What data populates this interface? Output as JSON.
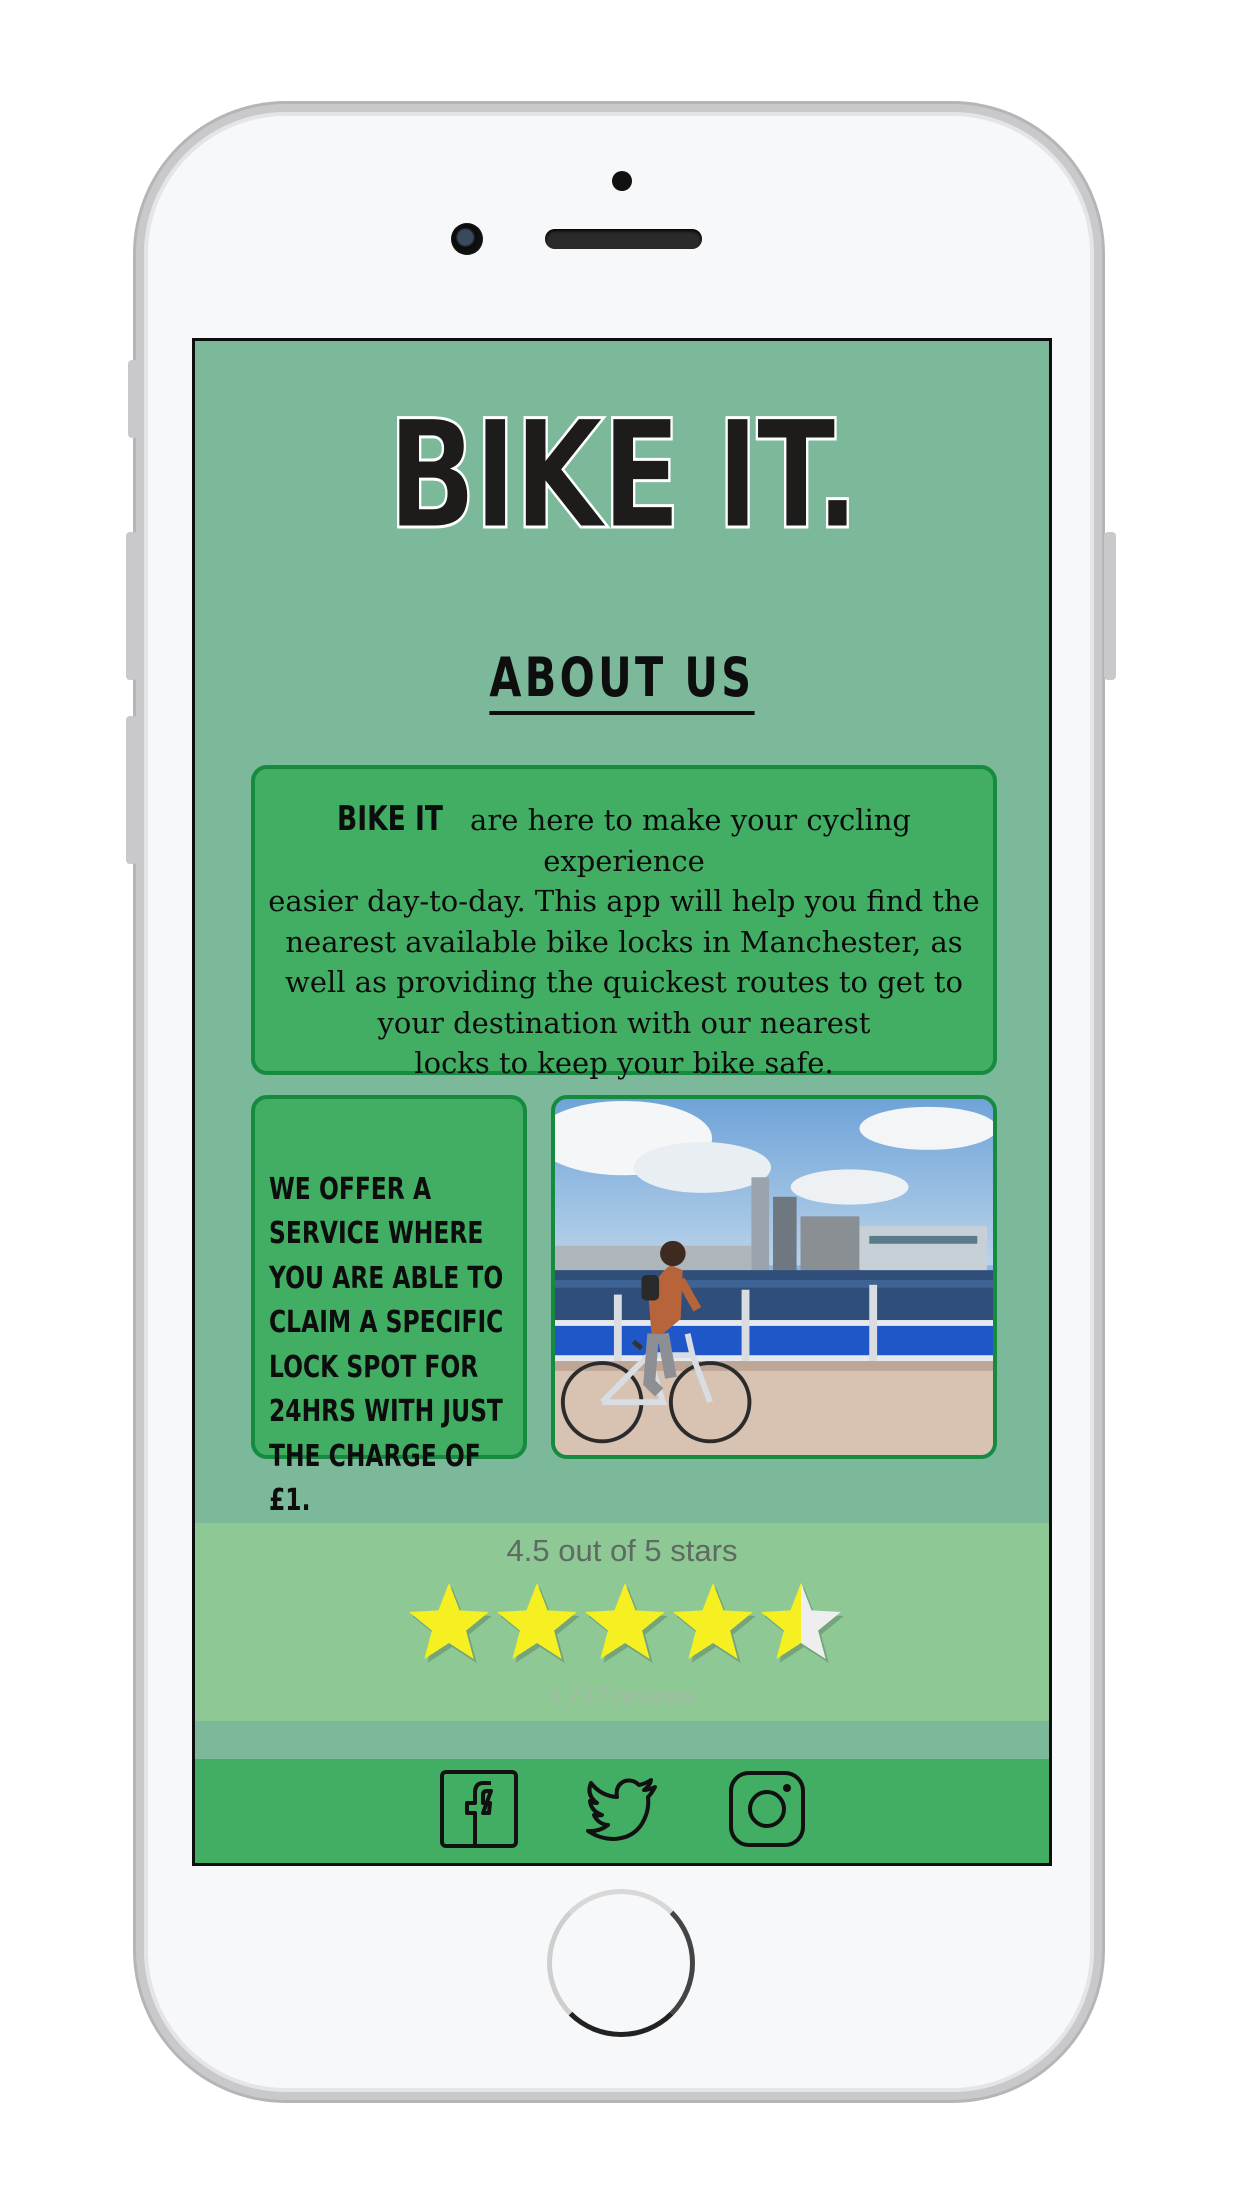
{
  "app": {
    "logo_text": "BIKE IT.",
    "page_title": "ABOUT US"
  },
  "intro": {
    "brand": "BIKE IT",
    "line1": "are here to make your cycling experience",
    "line2": "easier day-to-day. This app will help you find the",
    "line3": "nearest available bike locks in Manchester, as",
    "line4": "well as providing the quickest routes to get to",
    "line5": "your destination with our nearest",
    "line6": "locks to keep your bike safe."
  },
  "offer": {
    "text": " WE OFFER A\nSERVICE WHERE\nYOU ARE ABLE TO\nCLAIM A SPECIFIC\n LOCK SPOT FOR\n24HRS WITH JUST\nTHE CHARGE OF £1."
  },
  "rating": {
    "summary": "4.5 out of 5 stars",
    "value": 4.5,
    "max": 5,
    "reviews": "1,717 reviews"
  },
  "colors": {
    "screen_bg": "#7bb99a",
    "panel_green": "#41ae64",
    "panel_border": "#168a3f",
    "rating_band": "#8ec995",
    "star_fill": "#f6ef21"
  },
  "social": [
    "facebook-icon",
    "twitter-icon",
    "instagram-icon"
  ]
}
